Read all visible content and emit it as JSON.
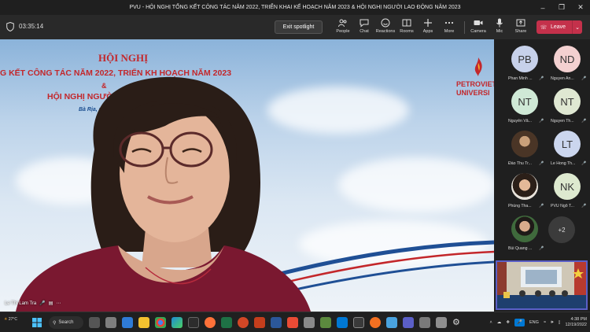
{
  "window": {
    "title": "PVU - HỘI NGHỊ TỔNG KẾT CÔNG TÁC NĂM 2022, TRIỂN KHAI KẾ HOẠCH NĂM 2023 & HỘI NGHỊ NGƯỜI LAO ĐỘNG NĂM 2023"
  },
  "toolbar": {
    "timer": "03:35:14",
    "exit_spotlight": "Exit spotlight",
    "people": "People",
    "chat": "Chat",
    "reactions": "Reactions",
    "rooms": "Rooms",
    "apps": "Apps",
    "more": "More",
    "camera": "Camera",
    "mic": "Mic",
    "share": "Share",
    "leave": "Leave"
  },
  "stage": {
    "banner_line1": "HỘI NGHỊ",
    "banner_line2": "G KẾT CÔNG TÁC NĂM 2022, TRIỂN KH     HOẠCH NĂM 2023",
    "banner_amp": "&",
    "banner_line3": "HỘI NGHỊ NGƯỜI L",
    "banner_line4": "Bà Rịa, ng",
    "logo_line1": "PETROVIET",
    "logo_line2": "UNIVERSI",
    "speaker_name": "Le Thi Lam Tra"
  },
  "participants": [
    {
      "initials": "PB",
      "name": "Phan Minh ...",
      "color": "#c7d1ea"
    },
    {
      "initials": "ND",
      "name": "Nguyen An...",
      "color": "#f3d0d0"
    },
    {
      "initials": "NT",
      "name": "Nguyễn Vă...",
      "color": "#cfe9d6"
    },
    {
      "initials": "NT",
      "name": "Nguyen Th...",
      "color": "#dfe8d2"
    },
    {
      "initials": "",
      "name": "Đào Thu Tr...",
      "color": "#5a4a3a"
    },
    {
      "initials": "LT",
      "name": "Le Hong Th...",
      "color": "#cbd6ee"
    },
    {
      "initials": "",
      "name": "Phùng Tha...",
      "color": "#6a5545"
    },
    {
      "initials": "NK",
      "name": "PVU Ngô T...",
      "color": "#dde9cf"
    },
    {
      "initials": "",
      "name": "Bùi Quang ...",
      "color": "#3d5a3a"
    }
  ],
  "overflow_count": "+2",
  "taskbar": {
    "weather_temp": "27°C",
    "search": "Search",
    "lang": "ENG",
    "time": "4:38 PM",
    "date": "12/19/2022"
  }
}
